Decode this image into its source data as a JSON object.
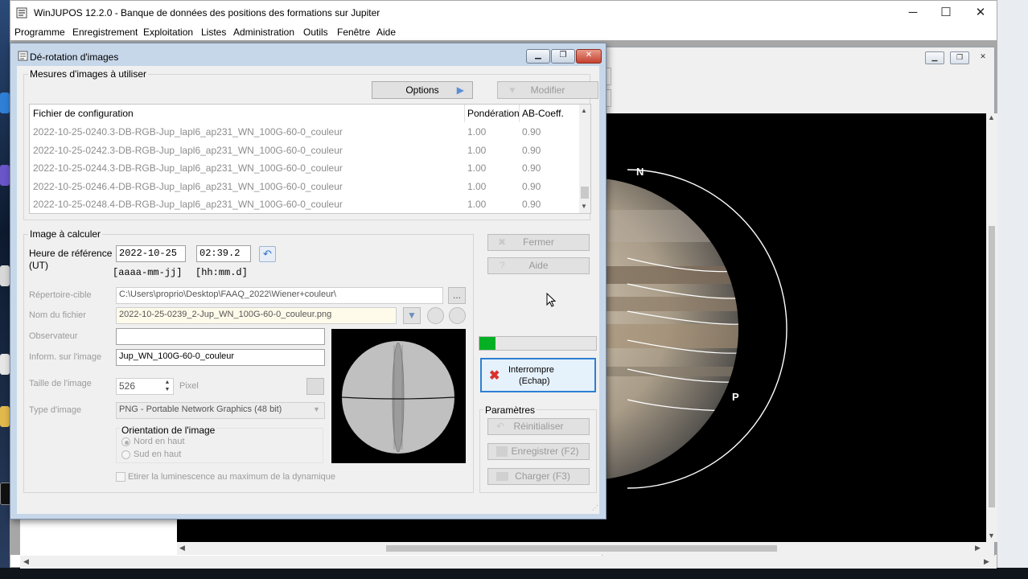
{
  "window": {
    "title": "WinJUPOS 12.2.0 - Banque de données des positions des formations sur Jupiter",
    "minimize": "─",
    "maximize": "☐",
    "close": "✕"
  },
  "menu": [
    "Programme",
    "Enregistrement",
    "Exploitation",
    "Listes",
    "Administration",
    "Outils",
    "Fenêtre",
    "Aide"
  ],
  "dialog": {
    "title": "Dé-rotation d'images",
    "measures": {
      "group_label": "Mesures d'images à utiliser",
      "options_label": "Options",
      "modify_label": "Modifier",
      "columns": [
        "Fichier de configuration",
        "Pondération",
        "AB-Coeff."
      ],
      "rows": [
        [
          "2022-10-25-0240.3-DB-RGB-Jup_lapl6_ap231_WN_100G-60-0_couleur",
          "1.00",
          "0.90"
        ],
        [
          "2022-10-25-0242.3-DB-RGB-Jup_lapl6_ap231_WN_100G-60-0_couleur",
          "1.00",
          "0.90"
        ],
        [
          "2022-10-25-0244.3-DB-RGB-Jup_lapl6_ap231_WN_100G-60-0_couleur",
          "1.00",
          "0.90"
        ],
        [
          "2022-10-25-0246.4-DB-RGB-Jup_lapl6_ap231_WN_100G-60-0_couleur",
          "1.00",
          "0.90"
        ],
        [
          "2022-10-25-0248.4-DB-RGB-Jup_lapl6_ap231_WN_100G-60-0_couleur",
          "1.00",
          "0.90"
        ]
      ],
      "scroll_position": 0.85
    },
    "image": {
      "group_label": "Image à calculer",
      "ref_time_label_1": "Heure de référence",
      "ref_time_label_2": "(UT)",
      "date_value": "2022-10-25",
      "time_value": "02:39.2",
      "date_hint": "[aaaa-mm-jj]",
      "time_hint": "[hh:mm.d]",
      "target_dir_label": "Répertoire-cible",
      "target_dir_value": "C:\\Users\\proprio\\Desktop\\FAAQ_2022\\Wiener+couleur\\",
      "browse_label": "...",
      "filename_label": "Nom du fichier",
      "filename_value": "2022-10-25-0239_2-Jup_WN_100G-60-0_couleur.png",
      "observer_label": "Observateur",
      "observer_value": "",
      "info_label": "Inform. sur l'image",
      "info_value": "Jup_WN_100G-60-0_couleur",
      "size_label": "Taille de l'image",
      "size_value": "526",
      "size_unit": "Pixel",
      "type_label": "Type d'image",
      "type_value": "PNG  - Portable Network Graphics (48 bit)",
      "orientation_label": "Orientation de l'image",
      "orientation_options": [
        "Nord en haut",
        "Sud en haut"
      ],
      "orientation_selected": "Nord en haut",
      "stretch_label": "Etirer la luminescence au maximum de la dynamique"
    },
    "actions": {
      "close_label": "Fermer",
      "help_label": "Aide",
      "progress_fraction": 0.14,
      "interrupt_label_1": "Interrompre",
      "interrupt_label_2": "(Echap)",
      "params_label": "Paramètres",
      "reset_label": "Réinitialiser",
      "save_label": "Enregistrer (F2)",
      "load_label": "Charger (F3)"
    }
  },
  "planet_view": {
    "north_label": "N",
    "p_label": "P"
  },
  "colors": {
    "progress": "#06b025",
    "interrupt_border": "#2d7fd3",
    "interrupt_icon": "#d9312b"
  }
}
